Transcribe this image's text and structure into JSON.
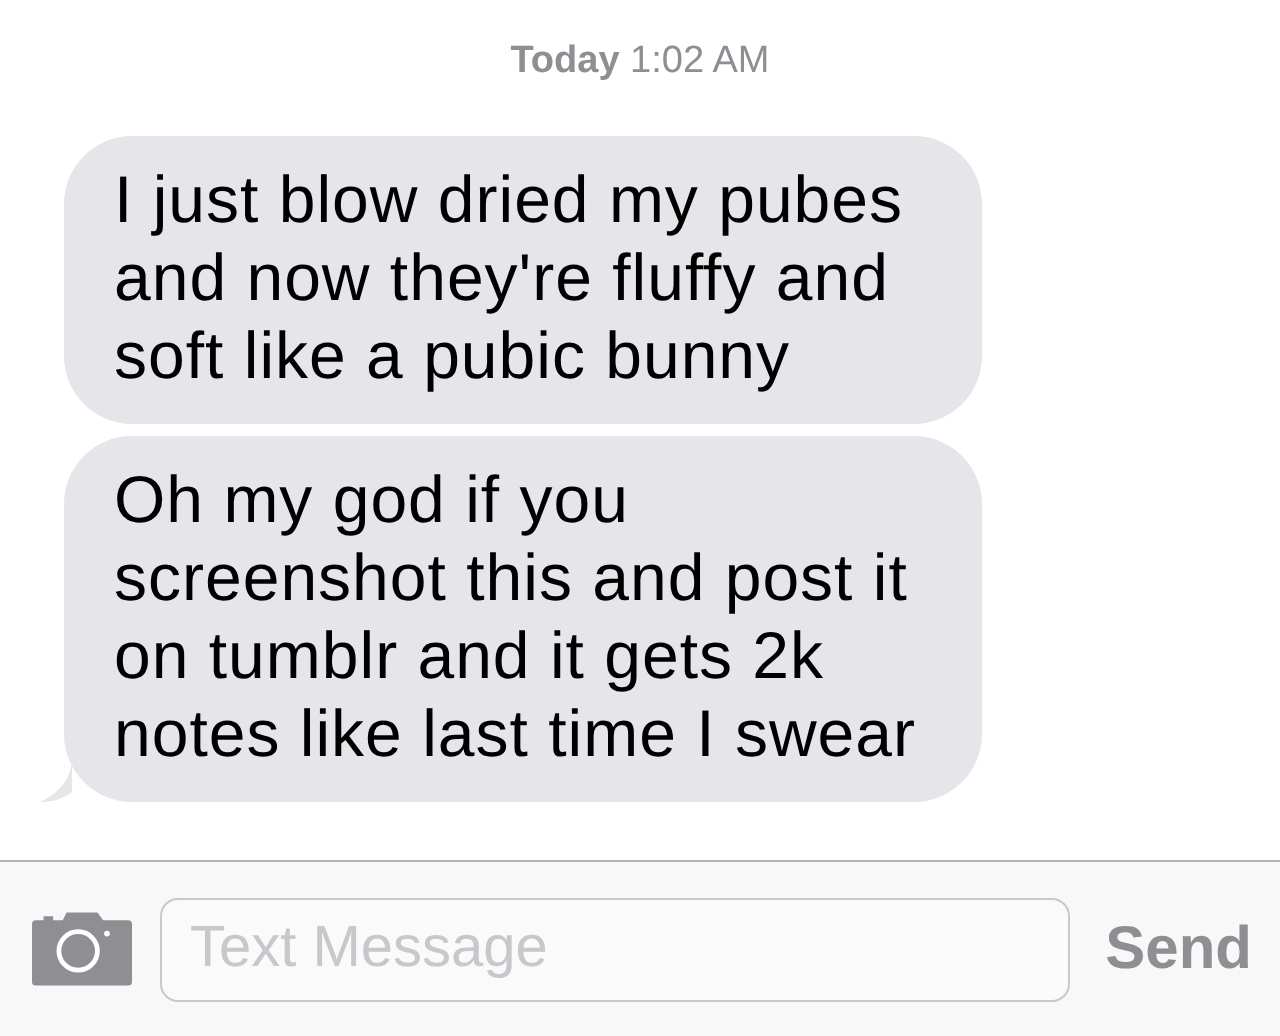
{
  "timestamp": "**Today** 1:02 AM",
  "messages": [
    {
      "text": "I just blow dried my pubes and now they're fluffy and soft like a pubic bunny",
      "tail": false
    },
    {
      "text": "Oh my god if you screenshot this and post it on tumblr and it gets 2k notes like last time I swear",
      "tail": true
    }
  ],
  "composer": {
    "placeholder": "Text Message",
    "send": "Send"
  }
}
